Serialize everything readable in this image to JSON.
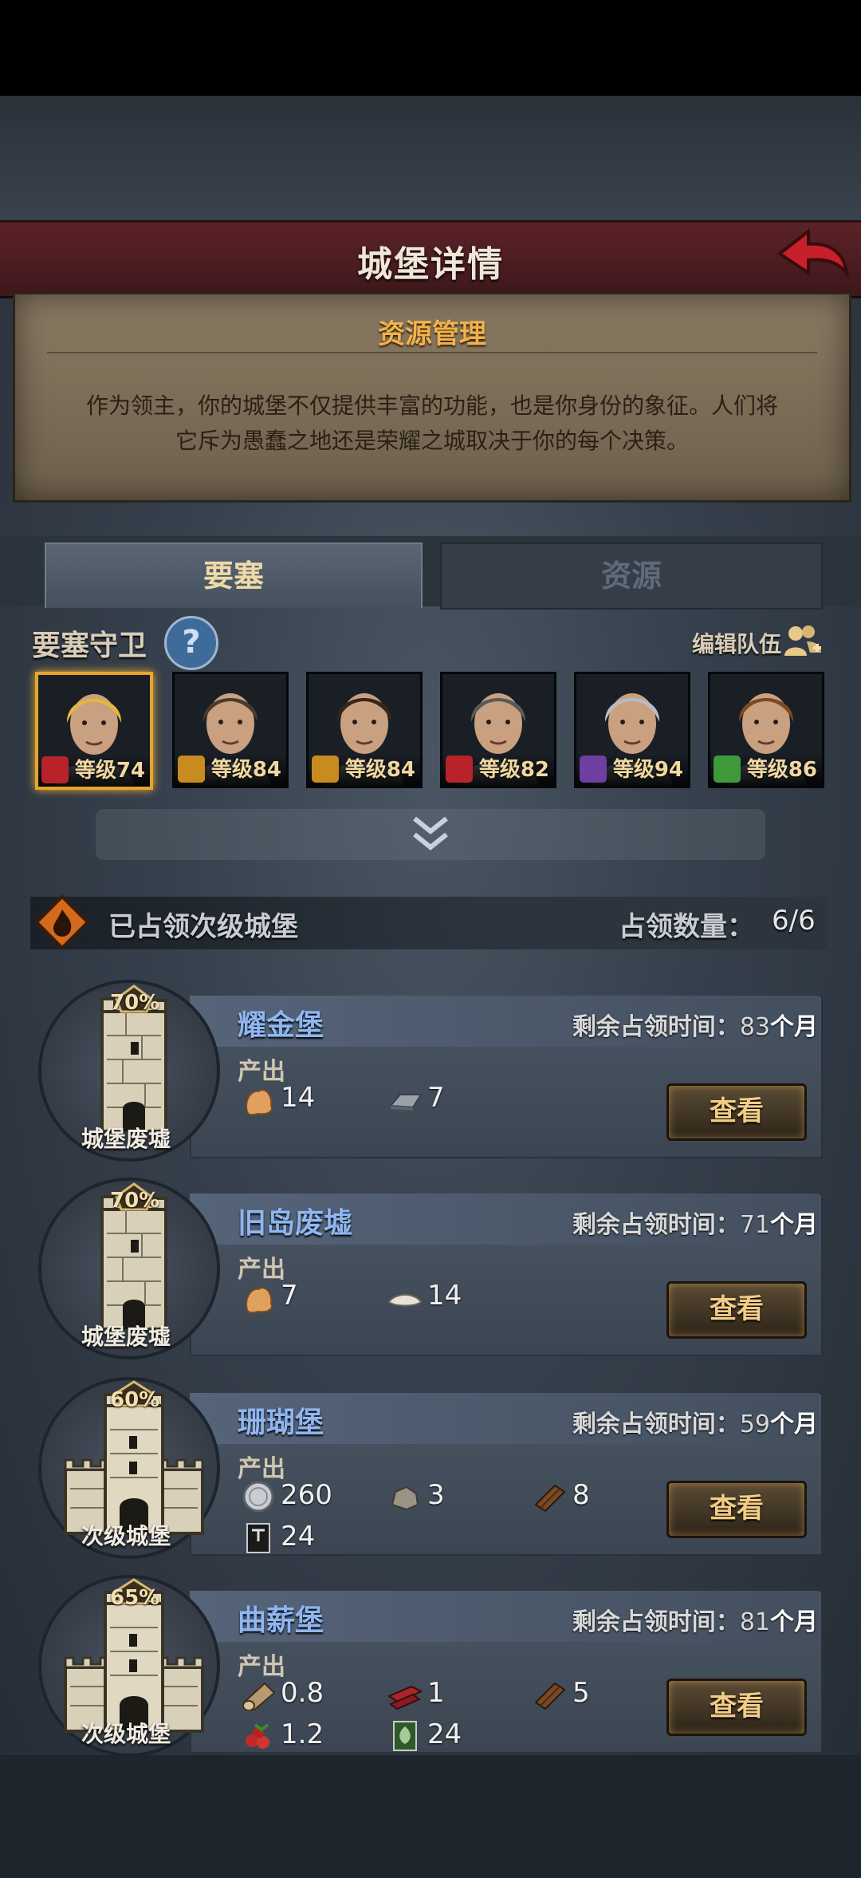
{
  "header": {
    "title": "城堡详情"
  },
  "info": {
    "title": "资源管理",
    "description_line1": "作为领主，你的城堡不仅提供丰富的功能，也是你身份的象征。人们将",
    "description_line2": "它斥为愚蠢之地还是荣耀之城取决于你的每个决策。"
  },
  "tabs": [
    {
      "label": "要塞",
      "active": true
    },
    {
      "label": "资源",
      "active": false
    }
  ],
  "guards": {
    "title": "要塞守卫",
    "help_glyph": "?",
    "edit_label": "编辑队伍",
    "heroes": [
      {
        "level": "等级74",
        "class_icon": "wolf-icon",
        "class_color": "#b8232a",
        "hair": "#e2b641",
        "selected": true
      },
      {
        "level": "等级84",
        "class_icon": "shield-icon",
        "class_color": "#c88b1d",
        "hair": "#4a3a2c",
        "selected": false
      },
      {
        "level": "等级84",
        "class_icon": "shield-icon",
        "class_color": "#c88b1d",
        "hair": "#3a2618",
        "selected": false
      },
      {
        "level": "等级82",
        "class_icon": "wolf-icon",
        "class_color": "#b8232a",
        "hair": "#5a5a5a",
        "selected": false
      },
      {
        "level": "等级94",
        "class_icon": "staff-icon",
        "class_color": "#6d3fa0",
        "hair": "#b8bcc2",
        "selected": false
      },
      {
        "level": "等级86",
        "class_icon": "bow-icon",
        "class_color": "#3e9a3a",
        "hair": "#7a4a22",
        "selected": false
      }
    ]
  },
  "occupied": {
    "title": "已占领次级城堡",
    "count_label": "占领数量：",
    "count_value": "6/6"
  },
  "castles": [
    {
      "name": "耀金堡",
      "percent": "70%",
      "type": "城堡废墟",
      "kind": "ruin",
      "remain_label": "剩余占领时间：",
      "remain_value": "83",
      "remain_unit": "个月",
      "output_label": "产出",
      "view_label": "查看",
      "resources": [
        {
          "icon": "grain-icon",
          "value": "14"
        },
        {
          "icon": "iron-ingot-icon",
          "value": "7"
        }
      ]
    },
    {
      "name": "旧岛废墟",
      "percent": "70%",
      "type": "城堡废墟",
      "kind": "ruin",
      "remain_label": "剩余占领时间：",
      "remain_value": "71",
      "remain_unit": "个月",
      "output_label": "产出",
      "view_label": "查看",
      "resources": [
        {
          "icon": "grain-icon",
          "value": "7"
        },
        {
          "icon": "salt-icon",
          "value": "14"
        }
      ]
    },
    {
      "name": "珊瑚堡",
      "percent": "60%",
      "type": "次级城堡",
      "kind": "castle",
      "remain_label": "剩余占领时间：",
      "remain_value": "59",
      "remain_unit": "个月",
      "output_label": "产出",
      "view_label": "查看",
      "resources": [
        {
          "icon": "silver-coin-icon",
          "value": "260"
        },
        {
          "icon": "stone-icon",
          "value": "3"
        },
        {
          "icon": "plank-icon",
          "value": "8"
        },
        {
          "icon": "black-banner-icon",
          "value": "24"
        }
      ]
    },
    {
      "name": "曲薪堡",
      "percent": "65%",
      "type": "次级城堡",
      "kind": "castle",
      "remain_label": "剩余占领时间：",
      "remain_value": "81",
      "remain_unit": "个月",
      "output_label": "产出",
      "view_label": "查看",
      "resources": [
        {
          "icon": "log-icon",
          "value": "0.8"
        },
        {
          "icon": "red-plank-icon",
          "value": "1"
        },
        {
          "icon": "plank-icon",
          "value": "5"
        },
        {
          "icon": "berries-icon",
          "value": "1.2"
        },
        {
          "icon": "green-banner-icon",
          "value": "24"
        }
      ]
    }
  ]
}
